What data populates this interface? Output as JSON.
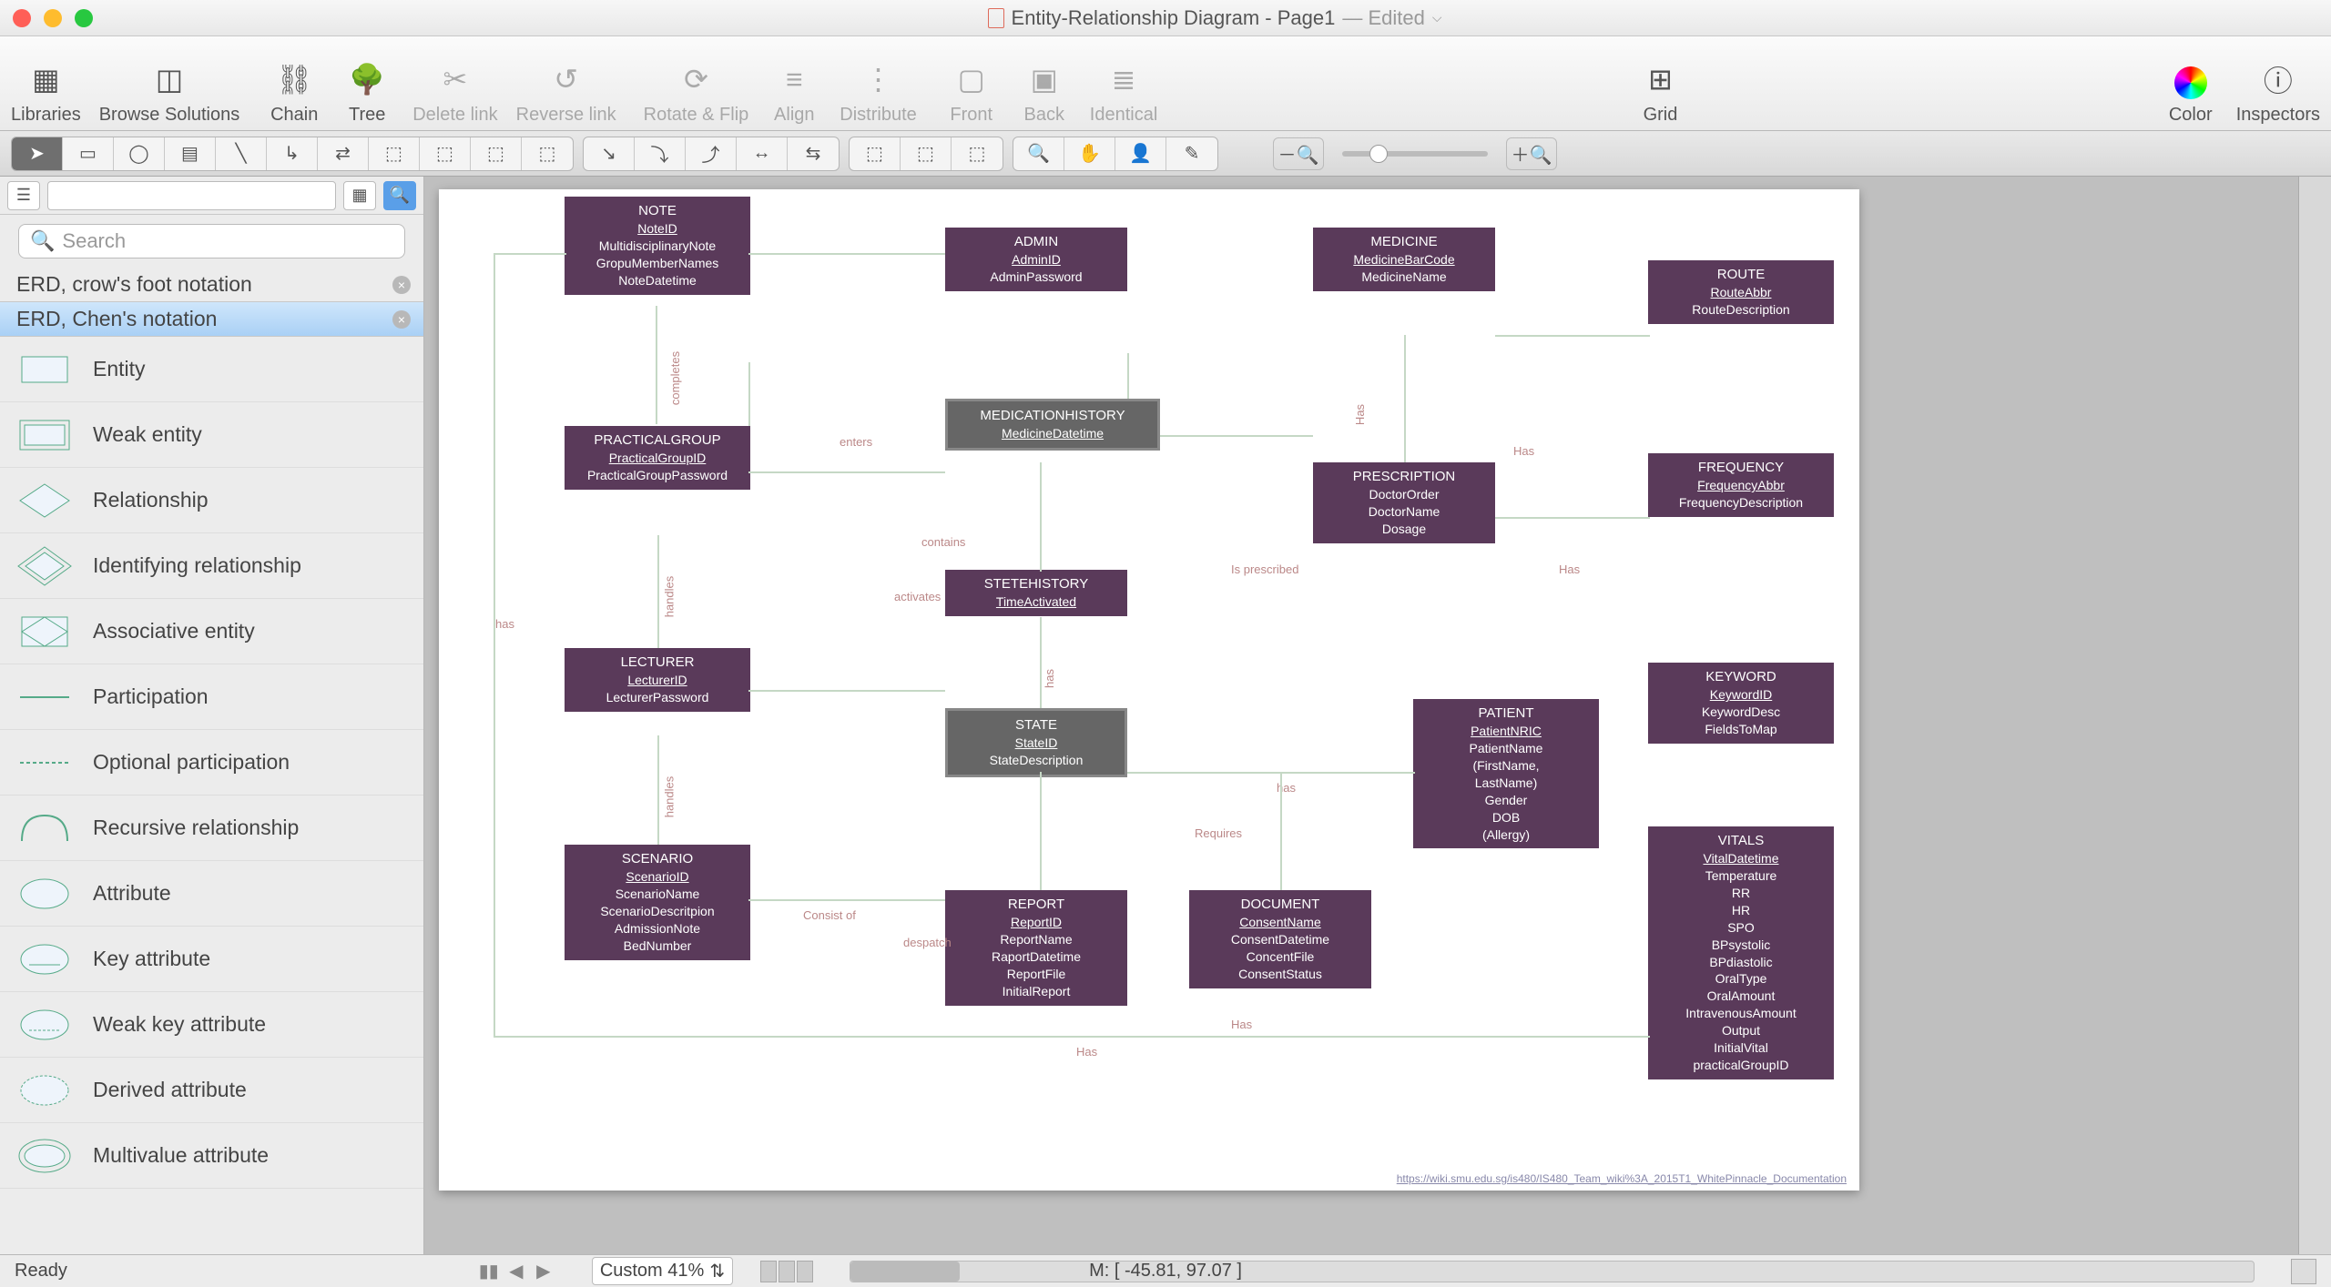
{
  "window": {
    "title": "Entity-Relationship Diagram - Page1",
    "edited": "— Edited"
  },
  "toolbar": [
    {
      "label": "Libraries",
      "icon": "libraries"
    },
    {
      "label": "Browse Solutions",
      "icon": "browse"
    },
    {
      "label": "Chain",
      "icon": "chain"
    },
    {
      "label": "Tree",
      "icon": "tree"
    },
    {
      "label": "Delete link",
      "icon": "delete-link",
      "disabled": true
    },
    {
      "label": "Reverse link",
      "icon": "reverse-link",
      "disabled": true
    },
    {
      "label": "Rotate & Flip",
      "icon": "rotate",
      "disabled": true
    },
    {
      "label": "Align",
      "icon": "align",
      "disabled": true
    },
    {
      "label": "Distribute",
      "icon": "distribute",
      "disabled": true
    },
    {
      "label": "Front",
      "icon": "front",
      "disabled": true
    },
    {
      "label": "Back",
      "icon": "back",
      "disabled": true
    },
    {
      "label": "Identical",
      "icon": "identical",
      "disabled": true
    },
    {
      "label": "Grid",
      "icon": "grid"
    },
    {
      "label": "Color",
      "icon": "color"
    },
    {
      "label": "Inspectors",
      "icon": "info"
    }
  ],
  "sidebar": {
    "search_placeholder": "Search",
    "sections": [
      {
        "label": "ERD, crow's foot notation",
        "selected": false
      },
      {
        "label": "ERD, Chen's notation",
        "selected": true
      }
    ],
    "shapes": [
      {
        "label": "Entity"
      },
      {
        "label": "Weak entity"
      },
      {
        "label": "Relationship"
      },
      {
        "label": "Identifying relationship"
      },
      {
        "label": "Associative entity"
      },
      {
        "label": "Participation"
      },
      {
        "label": "Optional participation"
      },
      {
        "label": "Recursive relationship"
      },
      {
        "label": "Attribute"
      },
      {
        "label": "Key attribute"
      },
      {
        "label": "Weak key attribute"
      },
      {
        "label": "Derived attribute"
      },
      {
        "label": "Multivalue attribute"
      }
    ]
  },
  "entities": {
    "note": {
      "name": "NOTE",
      "attrs": [
        "NoteID",
        "MultidisciplinaryNote",
        "GropuMemberNames",
        "NoteDatetime"
      ],
      "key": 0
    },
    "admin": {
      "name": "ADMIN",
      "attrs": [
        "AdminID",
        "AdminPassword"
      ],
      "key": 0
    },
    "medicine": {
      "name": "MEDICINE",
      "attrs": [
        "MedicineBarCode",
        "MedicineName"
      ],
      "key": 0
    },
    "route": {
      "name": "ROUTE",
      "attrs": [
        "RouteAbbr",
        "RouteDescription"
      ],
      "key": 0
    },
    "practicalgroup": {
      "name": "PRACTICALGROUP",
      "attrs": [
        "PracticalGroupID",
        "PracticalGroupPassword"
      ],
      "key": 0
    },
    "medicationhistory": {
      "name": "MEDICATIONHISTORY",
      "attrs": [
        "MedicineDatetime"
      ],
      "key": 0,
      "selected": true
    },
    "prescription": {
      "name": "PRESCRIPTION",
      "attrs": [
        "DoctorOrder",
        "DoctorName",
        "Dosage"
      ]
    },
    "frequency": {
      "name": "FREQUENCY",
      "attrs": [
        "FrequencyAbbr",
        "FrequencyDescription"
      ],
      "key": 0
    },
    "stetehistory": {
      "name": "STETEHISTORY",
      "attrs": [
        "TimeActivated"
      ],
      "key": 0
    },
    "lecturer": {
      "name": "LECTURER",
      "attrs": [
        "LecturerID",
        "LecturerPassword"
      ],
      "key": 0
    },
    "state": {
      "name": "STATE",
      "attrs": [
        "StateID",
        "StateDescription"
      ],
      "key": 0,
      "selected": true
    },
    "keyword": {
      "name": "KEYWORD",
      "attrs": [
        "KeywordID",
        "KeywordDesc",
        "FieldsToMap"
      ],
      "key": 0
    },
    "patient": {
      "name": "PATIENT",
      "attrs": [
        "PatientNRIC",
        "PatientName",
        "(FirstName,",
        "LastName)",
        "Gender",
        "DOB",
        "(Allergy)"
      ],
      "key": 0
    },
    "scenario": {
      "name": "SCENARIO",
      "attrs": [
        "ScenarioID",
        "ScenarioName",
        "ScenarioDescritpion",
        "AdmissionNote",
        "BedNumber"
      ],
      "key": 0
    },
    "report": {
      "name": "REPORT",
      "attrs": [
        "ReportID",
        "ReportName",
        "RaportDatetime",
        "ReportFile",
        "InitialReport"
      ],
      "key": 0
    },
    "document": {
      "name": "DOCUMENT",
      "attrs": [
        "ConsentName",
        "ConsentDatetime",
        "ConcentFile",
        "ConsentStatus"
      ],
      "key": 0
    },
    "vitals": {
      "name": "VITALS",
      "attrs": [
        "VitalDatetime",
        "Temperature",
        "RR",
        "HR",
        "SPO",
        "BPsystolic",
        "BPdiastolic",
        "OralType",
        "OralAmount",
        "IntravenousAmount",
        "Output",
        "InitialVital",
        "practicalGroupID"
      ],
      "key": 0
    }
  },
  "labels": {
    "enters": "enters",
    "completes": "completes",
    "has": "has",
    "Has": "Has",
    "contains": "contains",
    "activates": "activates",
    "handles": "handles",
    "Consist_of": "Consist of",
    "despatch": "despatch",
    "Requires": "Requires",
    "Is_prescribed": "Is prescribed"
  },
  "status": {
    "ready": "Ready",
    "mouse": "M: [ -45.81, 97.07 ]",
    "zoom": "Custom 41%"
  },
  "footer_link": "https://wiki.smu.edu.sg/is480/IS480_Team_wiki%3A_2015T1_WhitePinnacle_Documentation"
}
